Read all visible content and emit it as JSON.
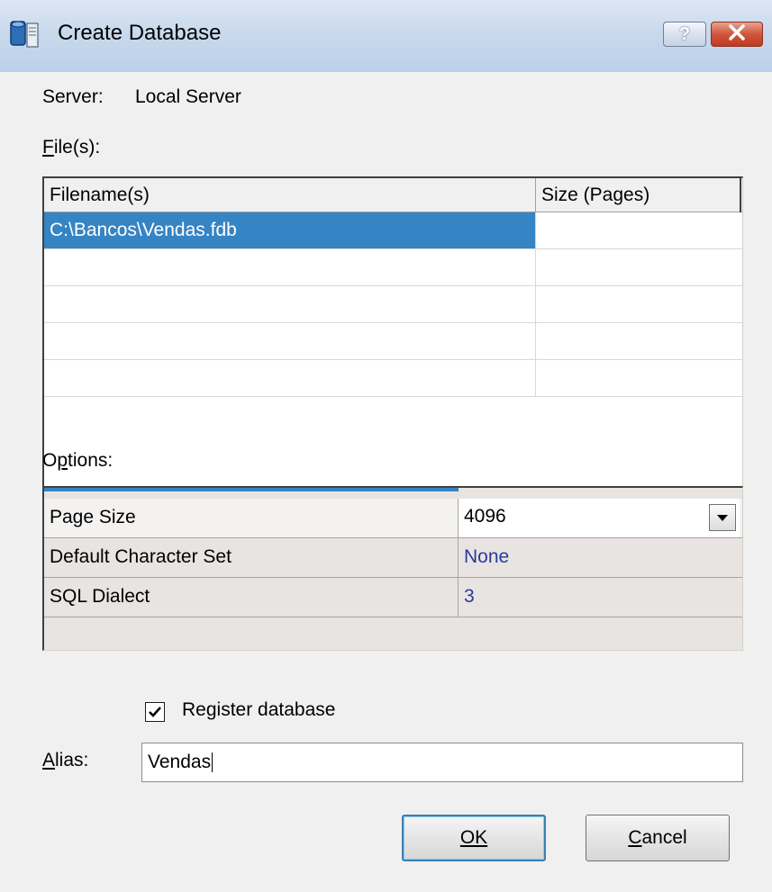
{
  "window": {
    "title": "Create Database",
    "help_label": "?",
    "close_label": "✕",
    "icon": "database-icon"
  },
  "server": {
    "label": "Server:",
    "value": "Local Server"
  },
  "files": {
    "label": "File(s):",
    "columns": [
      "Filename(s)",
      "Size (Pages)"
    ],
    "rows": [
      {
        "filename": "C:\\Bancos\\Vendas.fdb",
        "size": "",
        "selected": true
      },
      {
        "filename": "",
        "size": ""
      },
      {
        "filename": "",
        "size": ""
      },
      {
        "filename": "",
        "size": ""
      },
      {
        "filename": "",
        "size": ""
      }
    ]
  },
  "options": {
    "label": "Options:",
    "rows": [
      {
        "name": "Page Size",
        "value": "4096",
        "editor": "dropdown"
      },
      {
        "name": "Default Character Set",
        "value": "None"
      },
      {
        "name": "SQL Dialect",
        "value": "3"
      }
    ]
  },
  "register": {
    "label": "Register database",
    "checked": true
  },
  "alias": {
    "label": "Alias:",
    "value": "Vendas"
  },
  "buttons": {
    "ok": "OK",
    "cancel": "Cancel"
  },
  "colors": {
    "selection": "#3584c4",
    "option_value": "#2b3a9a",
    "dialog_bg": "#f0f0f0"
  }
}
